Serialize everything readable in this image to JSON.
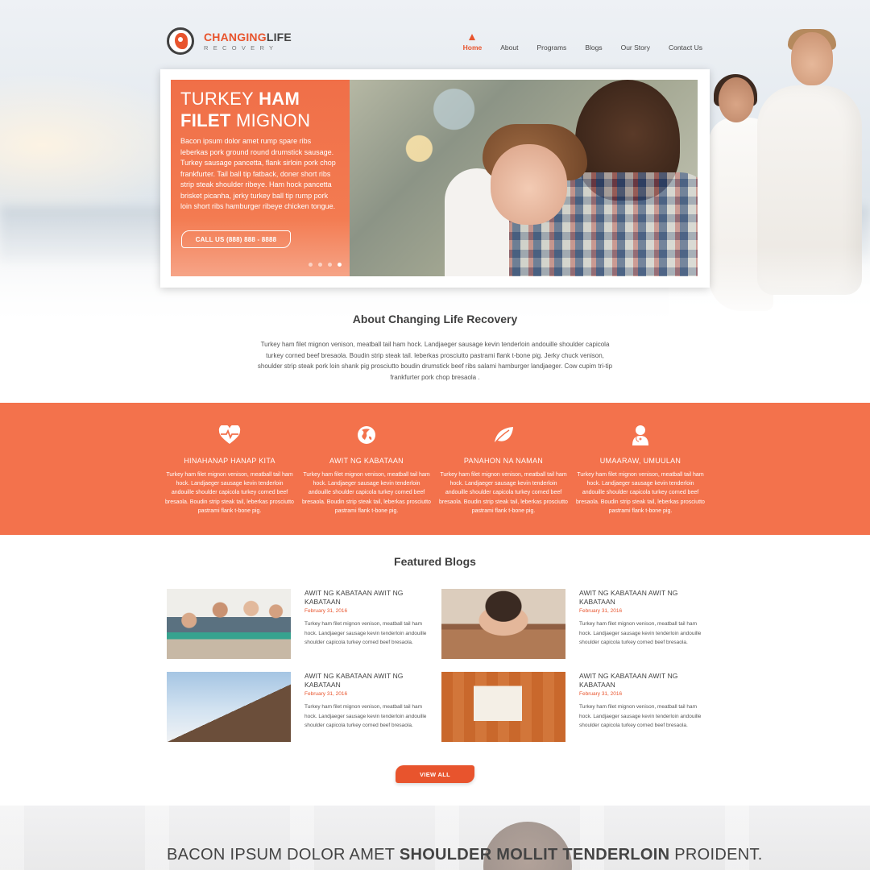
{
  "brand": {
    "name_bold": "CHANGING",
    "name_light": "LIFE",
    "tagline": "RECOVERY",
    "accent_color": "#e8542d",
    "band_color": "#f3724c"
  },
  "nav": {
    "items": [
      {
        "label": "Home",
        "active": true
      },
      {
        "label": "About"
      },
      {
        "label": "Programs"
      },
      {
        "label": "Blogs"
      },
      {
        "label": "Our Story"
      },
      {
        "label": "Contact Us"
      }
    ]
  },
  "slider": {
    "title_light_1": "TURKEY ",
    "title_bold_1": "HAM",
    "title_bold_2": "FILET",
    "title_light_2": " MIGNON",
    "body": "Bacon ipsum dolor amet rump spare ribs leberkas pork ground round drumstick sausage. Turkey sausage pancetta, flank sirloin pork chop frankfurter. Tail ball tip fatback, doner short ribs strip steak shoulder ribeye. Ham hock pancetta brisket picanha, jerky turkey ball tip rump pork loin short ribs hamburger ribeye chicken tongue.",
    "cta": "CALL US (888) 888 - 8888",
    "dots": 4,
    "active_dot": 4
  },
  "about": {
    "title": "About Changing Life Recovery",
    "body": "Turkey ham filet mignon venison, meatball tail ham hock. Landjaeger sausage kevin tenderloin andouille shoulder capicola turkey corned beef bresaola. Boudin strip steak tail. leberkas prosciutto pastrami flank t-bone pig. Jerky chuck venison, shoulder strip steak pork loin shank pig prosciutto boudin drumstick beef ribs salami hamburger landjaeger. Cow cupim tri-tip frankfurter pork chop bresaola ."
  },
  "features": [
    {
      "icon": "heart-pulse-icon",
      "title": "HINAHANAP HANAP KITA",
      "text": "Turkey ham filet mignon venison, meatball tail ham hock. Landjaeger sausage kevin tenderloin andouille shoulder capicola turkey corned beef bresaola. Boudin strip steak tail, leberkas prosciutto pastrami flank t-bone pig."
    },
    {
      "icon": "globe-icon",
      "title": "AWIT NG KABATAAN",
      "text": "Turkey ham filet mignon venison, meatball tail ham hock. Landjaeger sausage kevin tenderloin andouille shoulder capicola turkey corned beef bresaola. Boudin strip steak tail, leberkas prosciutto pastrami flank t-bone pig."
    },
    {
      "icon": "leaf-icon",
      "title": "PANAHON NA NAMAN",
      "text": "Turkey ham filet mignon venison, meatball tail ham hock. Landjaeger sausage kevin tenderloin andouille shoulder capicola turkey corned beef bresaola. Boudin strip steak tail, leberkas prosciutto pastrami flank t-bone pig."
    },
    {
      "icon": "doctor-icon",
      "title": "UMAARAW, UMUULAN",
      "text": "Turkey ham filet mignon venison, meatball tail ham hock. Landjaeger sausage kevin tenderloin andouille shoulder capicola turkey corned beef bresaola. Boudin strip steak tail, leberkas prosciutto pastrami flank t-bone pig."
    }
  ],
  "blogs": {
    "title": "Featured Blogs",
    "items": [
      {
        "title": "AWIT NG KABATAAN AWIT NG KABATAAN",
        "date": "February 31, 2016",
        "excerpt": "Turkey ham filet mignon venison, meatball tail ham hock. Landjaeger sausage kevin tenderloin andouille shoulder capicola turkey corned beef bresaola."
      },
      {
        "title": "AWIT NG KABATAAN AWIT NG KABATAAN",
        "date": "February 31, 2016",
        "excerpt": "Turkey ham filet mignon venison, meatball tail ham hock. Landjaeger sausage kevin tenderloin andouille shoulder capicola turkey corned beef bresaola."
      },
      {
        "title": "AWIT NG KABATAAN AWIT NG KABATAAN",
        "date": "February 31, 2016",
        "excerpt": "Turkey ham filet mignon venison, meatball tail ham hock. Landjaeger sausage kevin tenderloin andouille shoulder capicola turkey corned beef bresaola."
      },
      {
        "title": "AWIT NG KABATAAN AWIT NG KABATAAN",
        "date": "February 31, 2016",
        "excerpt": "Turkey ham filet mignon venison, meatball tail ham hock. Landjaeger sausage kevin tenderloin andouille shoulder capicola turkey corned beef bresaola."
      }
    ],
    "view_all": "VIEW ALL"
  },
  "bottom_banner": {
    "light_1": "BACON IPSUM DOLOR AMET ",
    "bold": "SHOULDER MOLLIT TENDERLOIN",
    "light_2": " PROIDENT."
  }
}
